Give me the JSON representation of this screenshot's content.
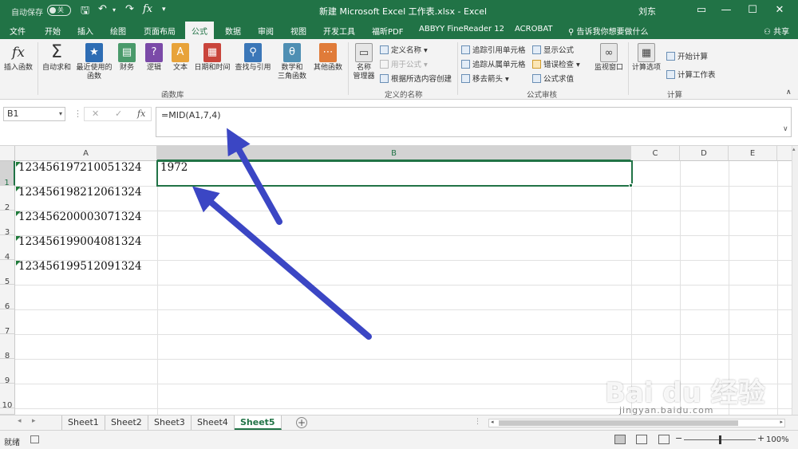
{
  "window": {
    "autosave_label": "自动保存",
    "autosave_state": "关",
    "title": "新建 Microsoft Excel 工作表.xlsx  -  Excel",
    "user": "刘东"
  },
  "ribbon_tabs": [
    "文件",
    "开始",
    "插入",
    "绘图",
    "页面布局",
    "公式",
    "数据",
    "审阅",
    "视图",
    "开发工具",
    "福昕PDF",
    "ABBYY FineReader 12",
    "ACROBAT"
  ],
  "active_tab": "公式",
  "tell_me": "告诉我你想要做什么",
  "share": "共享",
  "ribbon": {
    "insert_function": "插入函数",
    "autosum": "自动求和",
    "recent_1": "最近使用的",
    "recent_2": "函数",
    "financial": "财务",
    "logical": "逻辑",
    "text": "文本",
    "datetime": "日期和时间",
    "lookup": "查找与引用",
    "math_1": "数学和",
    "math_2": "三角函数",
    "other": "其他函数",
    "group_library": "函数库",
    "name_mgr_1": "名称",
    "name_mgr_2": "管理器",
    "define_name": "定义名称",
    "use_in_formula": "用于公式",
    "create_from_sel": "根据所选内容创建",
    "group_names": "定义的名称",
    "trace_precedents": "追踪引用单元格",
    "trace_dependents": "追踪从属单元格",
    "remove_arrows": "移去箭头",
    "show_formulas": "显示公式",
    "error_checking": "错误检查",
    "evaluate": "公式求值",
    "watch_window": "监视窗口",
    "group_audit": "公式审核",
    "calc_options": "计算选项",
    "calc_now": "开始计算",
    "calc_sheet": "计算工作表",
    "group_calc": "计算"
  },
  "formula_bar": {
    "name_box": "B1",
    "formula": "=MID(A1,7,4)"
  },
  "columns": [
    "A",
    "B",
    "C",
    "D",
    "E"
  ],
  "rows": [
    "1",
    "2",
    "3",
    "4",
    "5",
    "6",
    "7",
    "8",
    "9",
    "10"
  ],
  "cells": {
    "A1": "123456197210051324",
    "A2": "123456198212061324",
    "A3": "123456200003071324",
    "A4": "123456199004081324",
    "A5": "123456199512091324",
    "B1": "1972"
  },
  "sheets": [
    "Sheet1",
    "Sheet2",
    "Sheet3",
    "Sheet4",
    "Sheet5"
  ],
  "active_sheet": "Sheet5",
  "status": {
    "ready": "就绪",
    "zoom": "100%"
  },
  "colors": {
    "excel_green": "#217346",
    "arrow": "#3b46c4"
  },
  "watermark": "Bai du 经验",
  "watermark_url": "jingyan.baidu.com"
}
